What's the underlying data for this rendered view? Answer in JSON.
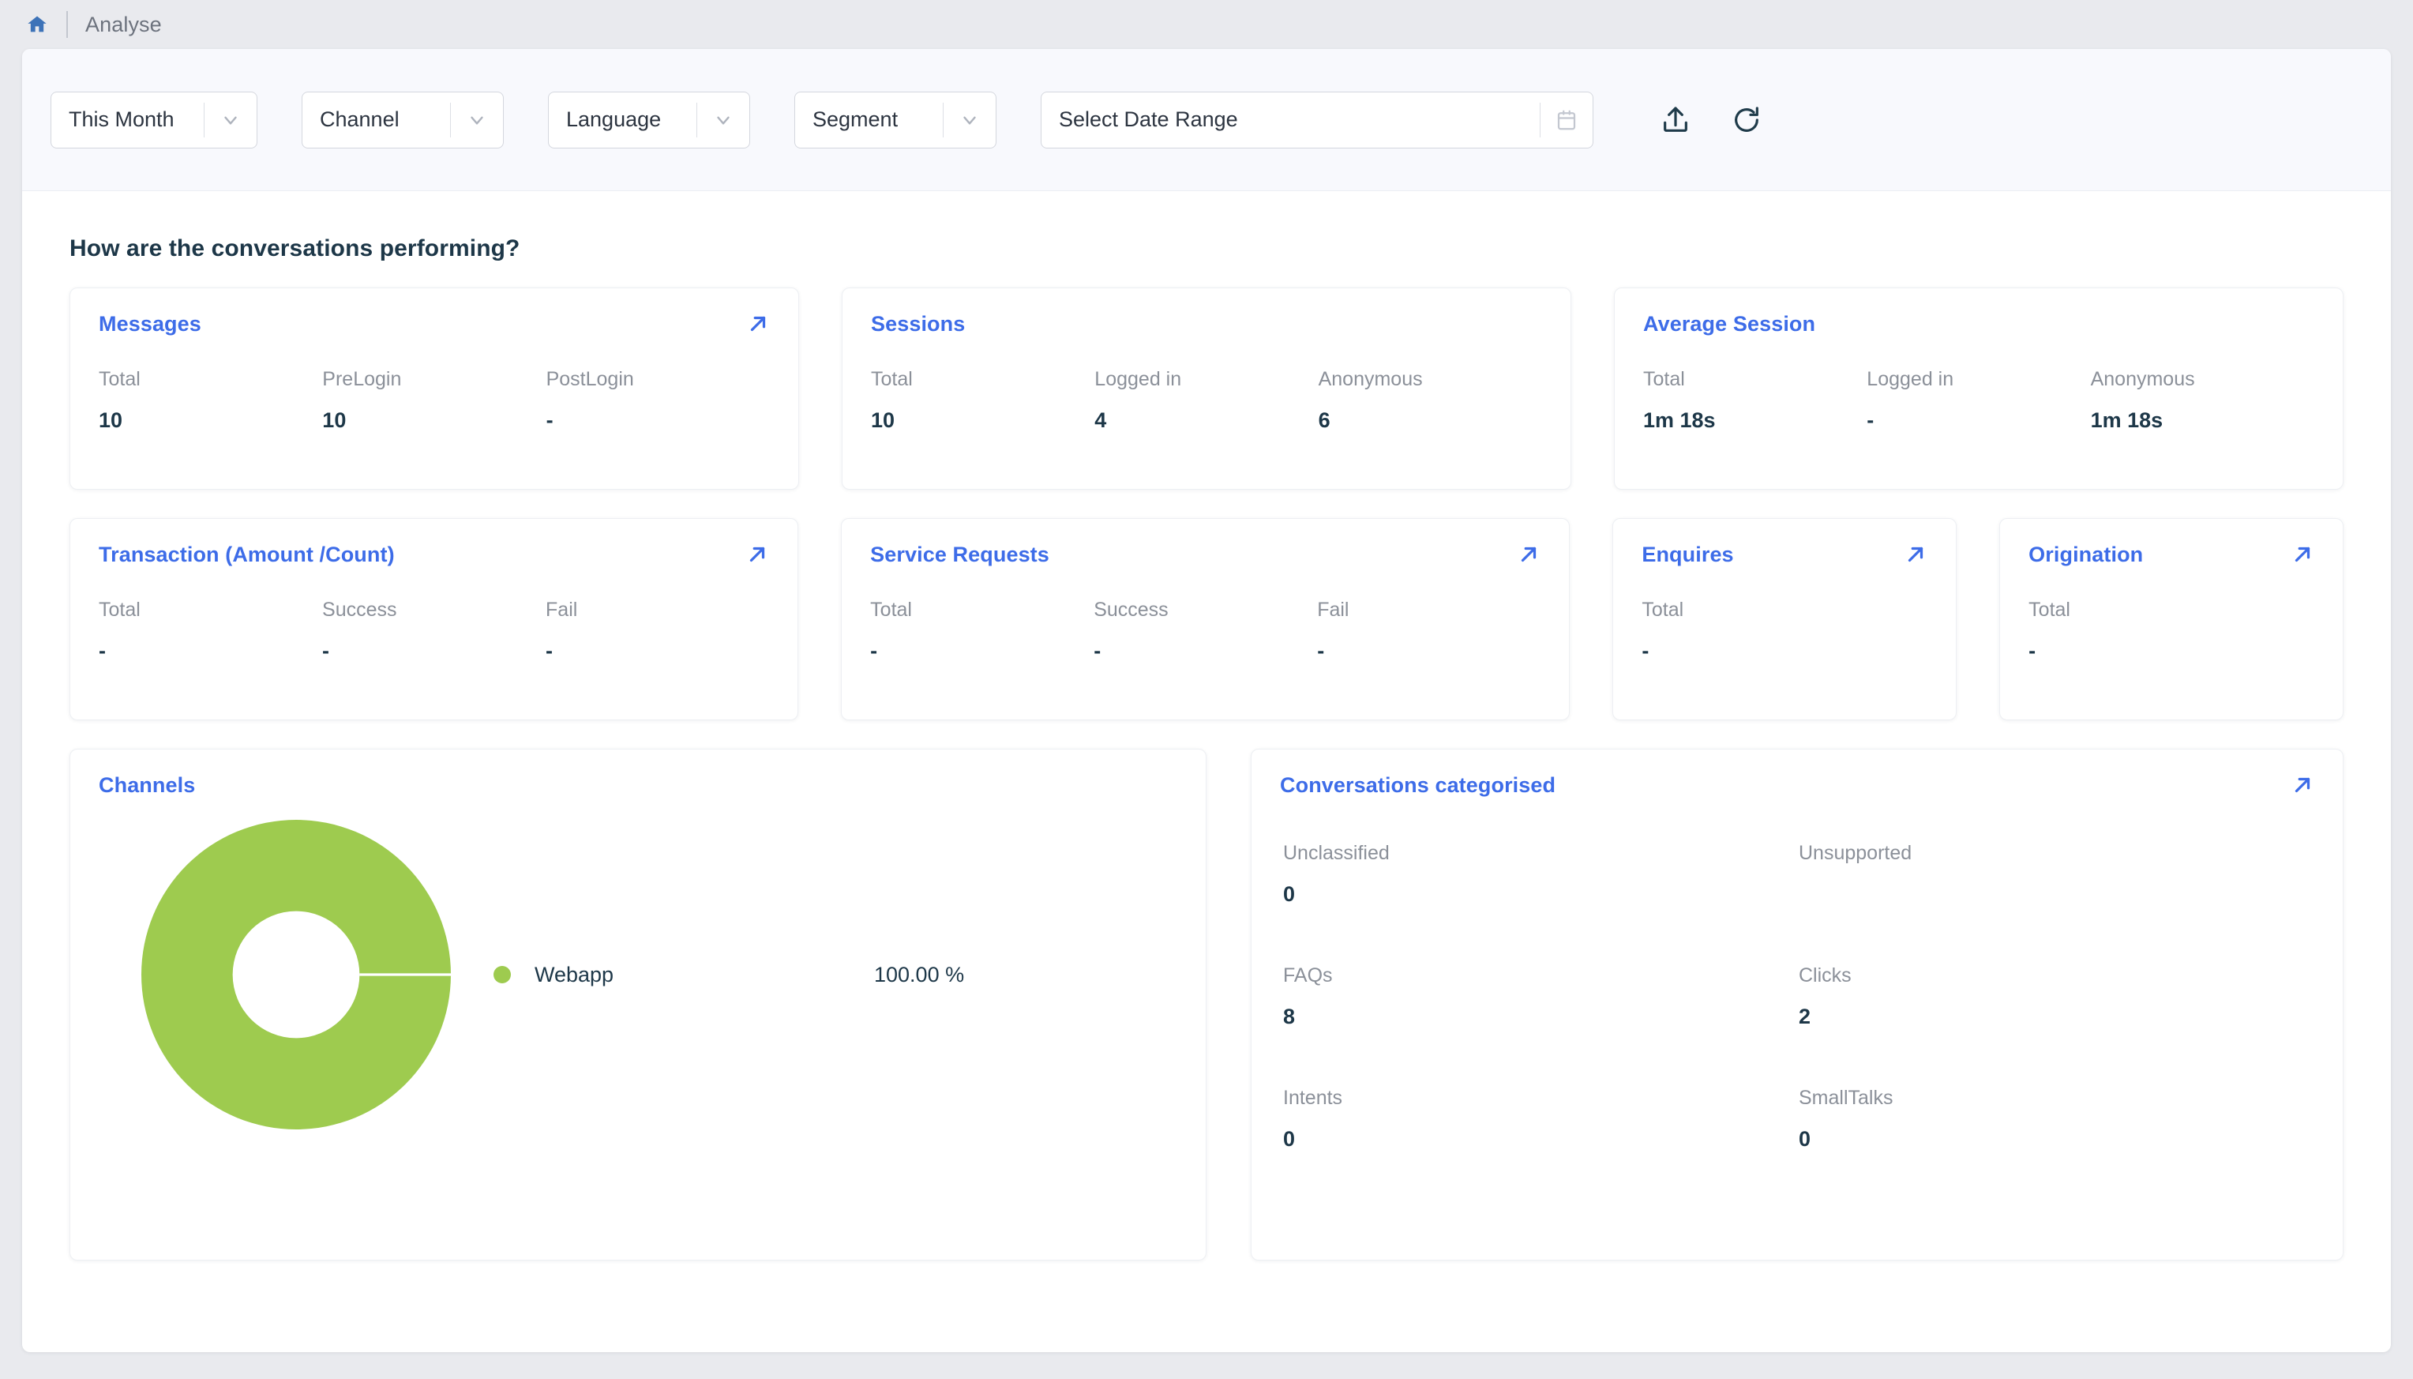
{
  "breadcrumb": {
    "home_icon": "home-icon",
    "label": "Analyse"
  },
  "filters": {
    "period": {
      "value": "This Month",
      "icon": "chevron-down-icon"
    },
    "channel": {
      "value": "Channel",
      "icon": "chevron-down-icon"
    },
    "language": {
      "value": "Language",
      "icon": "chevron-down-icon"
    },
    "segment": {
      "value": "Segment",
      "icon": "chevron-down-icon"
    },
    "date_range": {
      "value": "Select Date Range",
      "icon": "calendar-icon"
    },
    "export_icon": "upload-export-icon",
    "refresh_icon": "refresh-icon"
  },
  "section": {
    "title": "How are the conversations performing?"
  },
  "cards": {
    "messages": {
      "title": "Messages",
      "metrics": [
        {
          "label": "Total",
          "value": "10"
        },
        {
          "label": "PreLogin",
          "value": "10"
        },
        {
          "label": "PostLogin",
          "value": "-"
        }
      ]
    },
    "sessions": {
      "title": "Sessions",
      "metrics": [
        {
          "label": "Total",
          "value": "10"
        },
        {
          "label": "Logged in",
          "value": "4"
        },
        {
          "label": "Anonymous",
          "value": "6"
        }
      ]
    },
    "average_session": {
      "title": "Average Session",
      "metrics": [
        {
          "label": "Total",
          "value": "1m 18s"
        },
        {
          "label": "Logged in",
          "value": "-"
        },
        {
          "label": "Anonymous",
          "value": "1m 18s"
        }
      ]
    },
    "transaction": {
      "title": "Transaction (Amount /Count)",
      "metrics": [
        {
          "label": "Total",
          "value": "-"
        },
        {
          "label": "Success",
          "value": "-"
        },
        {
          "label": "Fail",
          "value": "-"
        }
      ]
    },
    "service_requests": {
      "title": "Service Requests",
      "metrics": [
        {
          "label": "Total",
          "value": "-"
        },
        {
          "label": "Success",
          "value": "-"
        },
        {
          "label": "Fail",
          "value": "-"
        }
      ]
    },
    "enquires": {
      "title": "Enquires",
      "metrics": [
        {
          "label": "Total",
          "value": "-"
        }
      ]
    },
    "origination": {
      "title": "Origination",
      "metrics": [
        {
          "label": "Total",
          "value": "-"
        }
      ]
    }
  },
  "channels": {
    "title": "Channels",
    "legend": [
      {
        "name": "Webapp",
        "percent": "100.00 %",
        "color": "#9ecb4f"
      }
    ]
  },
  "conversations_categorised": {
    "title": "Conversations categorised",
    "items": [
      {
        "label": "Unclassified",
        "value": "0"
      },
      {
        "label": "Unsupported",
        "value": ""
      },
      {
        "label": "FAQs",
        "value": "8"
      },
      {
        "label": "Clicks",
        "value": "2"
      },
      {
        "label": "Intents",
        "value": "0"
      },
      {
        "label": "SmallTalks",
        "value": "0"
      }
    ]
  },
  "colors": {
    "accent_blue": "#3d6ce8",
    "heading_navy": "#1d3748",
    "muted_gray": "#8b9099",
    "chart_green": "#9ecb4f",
    "page_bg": "#e9eaee",
    "filter_bar_bg": "#f8f9fd"
  },
  "chart_data": {
    "type": "pie",
    "title": "Channels",
    "labels": [
      "Webapp"
    ],
    "values": [
      100.0
    ],
    "display_values": [
      "100.00 %"
    ],
    "colors": [
      "#9ecb4f"
    ],
    "donut": true,
    "hole_ratio": 0.41,
    "legend_position": "right",
    "units": "percent"
  }
}
